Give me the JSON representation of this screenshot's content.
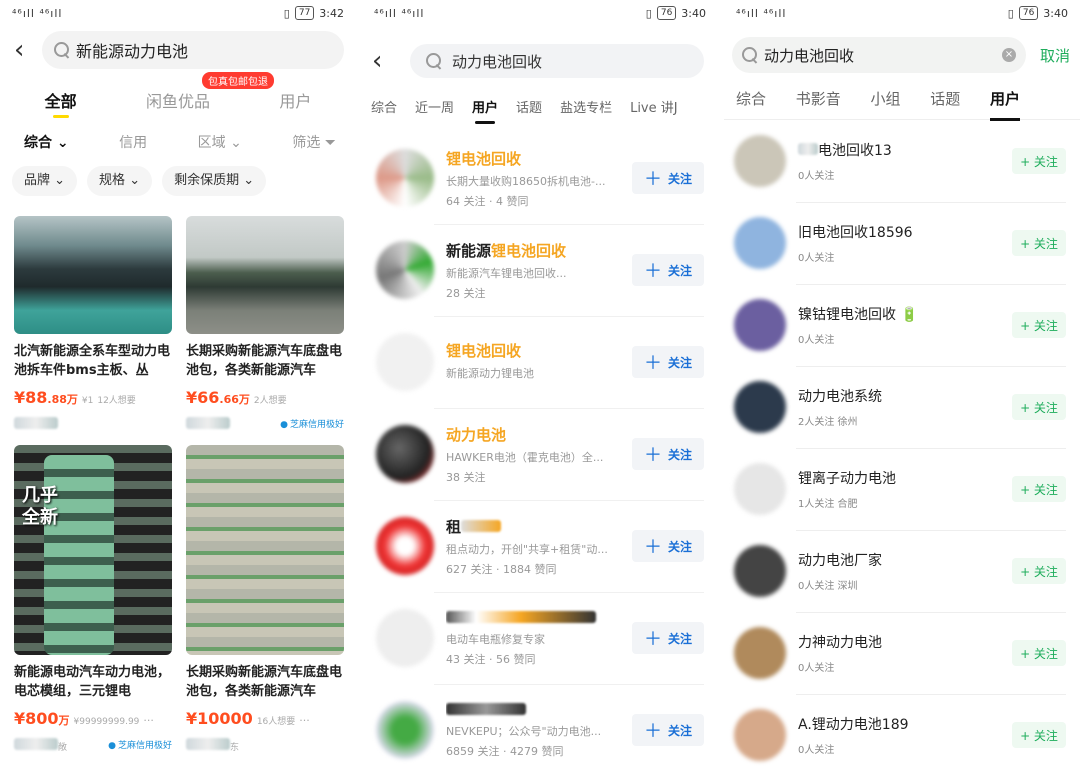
{
  "screen1": {
    "status": {
      "signal": "⁴⁶ıll ⁴⁶ıll",
      "battery": "77",
      "time": "3:42"
    },
    "search": {
      "query": "新能源动力电池"
    },
    "tabs": [
      "全部",
      "闲鱼优品",
      "用户"
    ],
    "tab_badge": "包真包邮包退",
    "filters": [
      "综合",
      "信用",
      "区域",
      "筛选"
    ],
    "chips": [
      "品牌",
      "规格",
      "剩余保质期"
    ],
    "items": [
      {
        "title": "北汽新能源全系车型动力电池拆车件bms主板、丛",
        "price_main": "88",
        "price_small": ".88万",
        "orig": "¥1",
        "want": "12人想要",
        "credit": ""
      },
      {
        "title": "长期采购新能源汽车底盘电池包，各类新能源汽车",
        "price_main": "66",
        "price_small": ".66万",
        "orig": "",
        "want": "2人想要",
        "credit": "芝麻信用极好"
      },
      {
        "title": "新能源电动汽车动力电池，电芯模组，三元锂电",
        "price_main": "800",
        "price_small": "万",
        "orig": "¥99999999.99",
        "want": "",
        "credit": "芝麻信用极好",
        "seller_suffix": "敞"
      },
      {
        "title": "长期采购新能源汽车底盘电池包，各类新能源汽车",
        "price_main": "10000",
        "price_small": "",
        "orig": "",
        "want": "16人想要",
        "credit": "",
        "seller_suffix": "东"
      }
    ],
    "image_overlay": "几乎\n全新"
  },
  "screen2": {
    "status": {
      "signal": "⁴⁶ıll ⁴⁶ıll",
      "battery": "76",
      "time": "3:40"
    },
    "search": {
      "query": "动力电池回收"
    },
    "tabs": [
      "综合",
      "近一周",
      "用户",
      "话题",
      "盐选专栏",
      "Live 讲J"
    ],
    "follow_label": "关注",
    "users": [
      {
        "name_pre": "",
        "name_hl": "锂电池回收",
        "desc": "长期大量收购18650拆机电池-...",
        "meta": "64 关注 · 4 赞同"
      },
      {
        "name_pre": "新能源",
        "name_hl": "锂电池回收",
        "desc": "新能源汽车锂电池回收...",
        "meta": "28 关注"
      },
      {
        "name_pre": "",
        "name_hl": "锂电池回收",
        "desc": "新能源动力锂电池",
        "meta": ""
      },
      {
        "name_pre": "",
        "name_hl": "动力电池",
        "desc": "HAWKER电池（霍克电池）全...",
        "meta": "38 关注"
      },
      {
        "name_pre": "租",
        "name_hl": "",
        "desc": "租点动力，开创\"共享+租赁\"动...",
        "meta": "627 关注 · 1884 赞同"
      },
      {
        "name_pre": "",
        "name_hl": "",
        "desc": "电动车电瓶修复专家",
        "meta": "43 关注 · 56 赞同"
      },
      {
        "name_pre": "",
        "name_hl": "",
        "desc": "NEVKEPU；公众号\"动力电池...",
        "meta": "6859 关注 · 4279 赞同"
      }
    ]
  },
  "screen3": {
    "status": {
      "signal": "⁴⁶ıll ⁴⁶ıll",
      "battery": "76",
      "time": "3:40"
    },
    "search": {
      "query": "动力电池回收"
    },
    "cancel": "取消",
    "tabs": [
      "综合",
      "书影音",
      "小组",
      "话题",
      "用户"
    ],
    "follow_label": "+ 关注",
    "groups": [
      {
        "name": "电池回收13",
        "meta": "0人关注"
      },
      {
        "name": "旧电池回收18596",
        "meta": "0人关注"
      },
      {
        "name": "镍钴锂电池回收 🔋",
        "meta": "0人关注"
      },
      {
        "name": "动力电池系统",
        "meta": "2人关注 徐州"
      },
      {
        "name": "锂离子动力电池",
        "meta": "1人关注 合肥"
      },
      {
        "name": "动力电池厂家",
        "meta": "0人关注 深圳"
      },
      {
        "name": "力神动力电池",
        "meta": "0人关注"
      },
      {
        "name": "A.锂动力电池189",
        "meta": "0人关注"
      }
    ]
  }
}
